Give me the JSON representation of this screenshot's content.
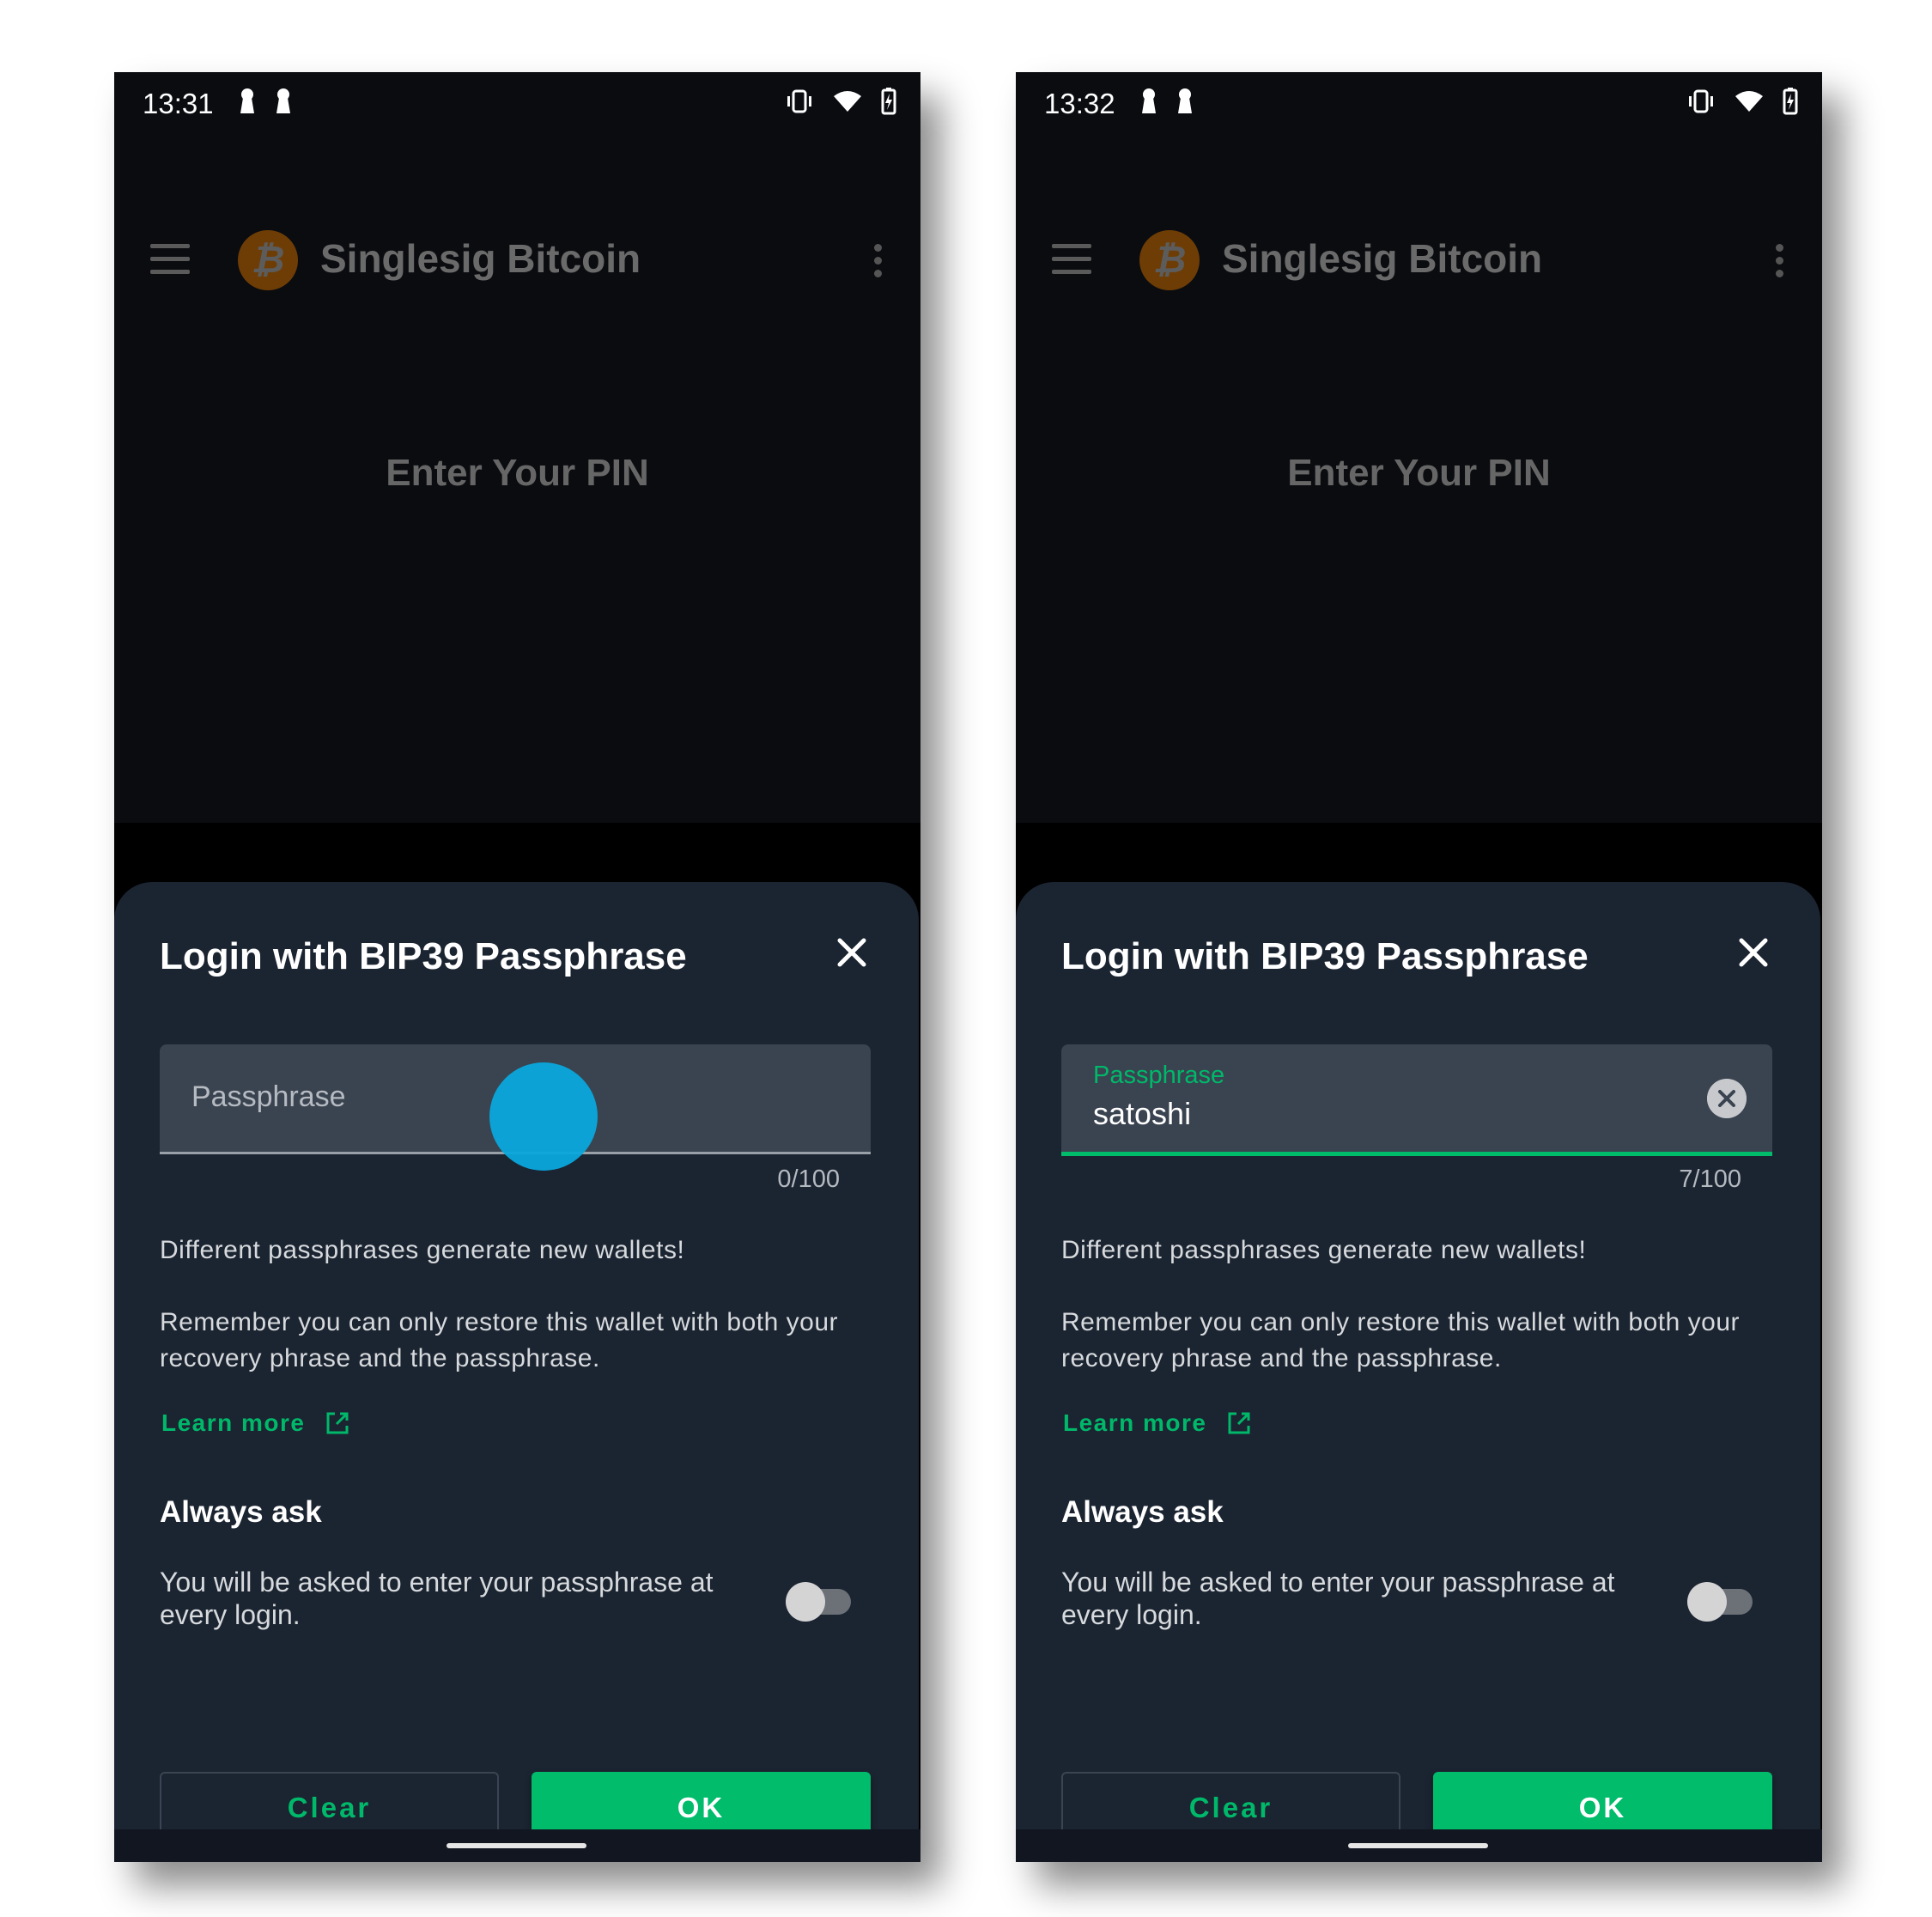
{
  "screens": [
    {
      "status_bar": {
        "time": "13:31"
      },
      "app_bar": {
        "title": "Singlesig Bitcoin",
        "logo_glyph": "₿"
      },
      "pin_title": "Enter Your PIN",
      "dialog": {
        "title": "Login with BIP39 Passphrase",
        "field": {
          "label": "Passphrase",
          "value": "",
          "counter": "0/100"
        },
        "info_1": "Different passphrases generate new wallets!",
        "info_2": "Remember you can only restore this wallet with both your recovery phrase and the passphrase.",
        "learn_more": "Learn more",
        "always_ask_title": "Always ask",
        "always_ask_desc": "You will be asked to enter your passphrase at every login.",
        "always_ask_enabled": false,
        "clear_label": "Clear",
        "ok_label": "OK"
      }
    },
    {
      "status_bar": {
        "time": "13:32"
      },
      "app_bar": {
        "title": "Singlesig Bitcoin",
        "logo_glyph": "₿"
      },
      "pin_title": "Enter Your PIN",
      "dialog": {
        "title": "Login with BIP39 Passphrase",
        "field": {
          "label": "Passphrase",
          "value": "satoshi",
          "counter": "7/100"
        },
        "info_1": "Different passphrases generate new wallets!",
        "info_2": "Remember you can only restore this wallet with both your recovery phrase and the passphrase.",
        "learn_more": "Learn more",
        "always_ask_title": "Always ask",
        "always_ask_desc": "You will be asked to enter your passphrase at every login.",
        "always_ask_enabled": false,
        "clear_label": "Clear",
        "ok_label": "OK"
      }
    }
  ],
  "colors": {
    "accent_green": "#00bc6b",
    "sheet_bg": "#1b2431",
    "screen_bg": "#0a0c10",
    "touch_indicator": "#0aa8dc",
    "bitcoin_orange_dim": "#6e3d06"
  }
}
